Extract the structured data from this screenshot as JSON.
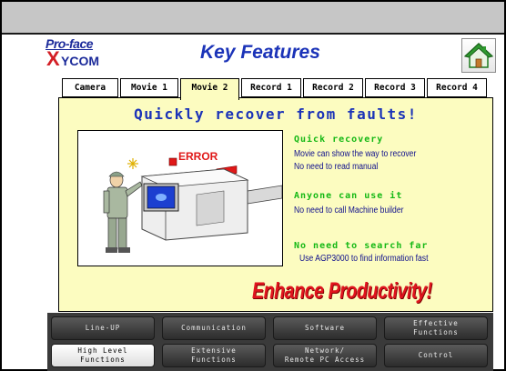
{
  "header": {
    "logo_top": "Pro-face",
    "logo_x": "X",
    "logo_bottom": "YCOM",
    "title": "Key Features"
  },
  "tabs": [
    {
      "label": "Camera",
      "active": false
    },
    {
      "label": "Movie 1",
      "active": false
    },
    {
      "label": "Movie 2",
      "active": true
    },
    {
      "label": "Record 1",
      "active": false
    },
    {
      "label": "Record 2",
      "active": false
    },
    {
      "label": "Record 3",
      "active": false
    },
    {
      "label": "Record 4",
      "active": false
    }
  ],
  "content": {
    "headline": "Quickly recover from faults!",
    "error_label": "ERROR",
    "features": [
      {
        "heading": "Quick recovery",
        "lines": [
          "Movie can show the way to recover",
          "No need to read manual"
        ]
      },
      {
        "heading": "Anyone can use it",
        "lines": [
          "No need to call Machine builder"
        ]
      },
      {
        "heading": "No need to search far",
        "lines": [
          "Use AGP3000 to find information fast"
        ]
      }
    ],
    "tagline": "Enhance Productivity!"
  },
  "menu": [
    {
      "label": "Line-UP",
      "selected": false
    },
    {
      "label": "Communication",
      "selected": false
    },
    {
      "label": "Software",
      "selected": false
    },
    {
      "label": "Effective\nFunctions",
      "selected": false
    },
    {
      "label": "High Level\nFunctions",
      "selected": true
    },
    {
      "label": "Extensive\nFunctions",
      "selected": false
    },
    {
      "label": "Network/\nRemote PC Access",
      "selected": false
    },
    {
      "label": "Control",
      "selected": false
    }
  ],
  "icons": {
    "home": "home-icon"
  },
  "colors": {
    "panel_bg": "#fcfcc0",
    "headline": "#1b33b8",
    "feature_heading": "#14b814",
    "tagline": "#e0141e"
  }
}
